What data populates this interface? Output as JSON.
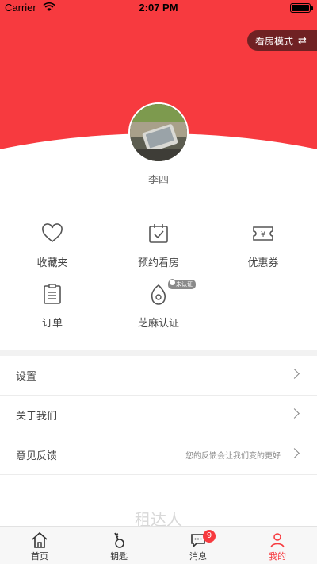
{
  "status_bar": {
    "carrier": "Carrier",
    "time": "2:07 PM",
    "battery_level": 1.0
  },
  "header": {
    "mode_button_label": "看房模式",
    "mode_button_icon": "swap-arrows-icon",
    "accent_color": "#f73a3f"
  },
  "profile": {
    "username": "李四"
  },
  "quick_actions": [
    {
      "label": "收藏夹",
      "icon": "heart-icon"
    },
    {
      "label": "预约看房",
      "icon": "calendar-check-icon"
    },
    {
      "label": "优惠券",
      "icon": "coupon-icon"
    },
    {
      "label": "订单",
      "icon": "clipboard-icon"
    },
    {
      "label": "芝麻认证",
      "icon": "sesame-icon",
      "badge": "未认证"
    }
  ],
  "menu": [
    {
      "label": "设置",
      "hint": ""
    },
    {
      "label": "关于我们",
      "hint": ""
    },
    {
      "label": "意见反馈",
      "hint": "您的反馈会让我们变的更好"
    }
  ],
  "brand_text": "租达人",
  "tabbar": {
    "tabs": [
      {
        "label": "首页",
        "icon": "home-icon"
      },
      {
        "label": "钥匙",
        "icon": "key-icon"
      },
      {
        "label": "消息",
        "icon": "chat-icon",
        "badge": "9"
      },
      {
        "label": "我的",
        "icon": "user-icon"
      }
    ],
    "active_index": 3
  }
}
